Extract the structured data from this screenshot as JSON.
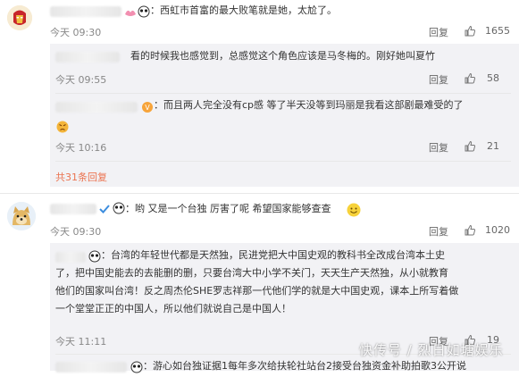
{
  "comments": [
    {
      "text": "：西虹市首富的最大败笔就是她，太尬了。",
      "time": "今天 09:30",
      "reply": "回复",
      "likes": "1655",
      "replies": [
        {
          "text": "看的时候我也感觉到，总感觉这个角色应该是马冬梅的。刚好她叫夏竹",
          "time": "今天 09:55",
          "reply": "回复",
          "likes": "58"
        },
        {
          "text": "：而且两人完全没有cp感 等了半天没等到玛丽是我看这部剧最难受的了",
          "time": "今天 10:16",
          "reply": "回复",
          "likes": "21"
        }
      ],
      "more_replies": "共31条回复"
    },
    {
      "text": "：哟 又是一个台独 厉害了呢 希望国家能够查查",
      "time": "今天 09:30",
      "reply": "回复",
      "likes": "1020",
      "replies": [
        {
          "lines": [
            "：台湾的年轻世代都是天然独，民进党把大中国史观的教科书全改成台湾本土史",
            "了，把中国史能去的去能删的删，只要台湾大中小学不关门，天天生产天然独，从小就教育",
            "他们的国家叫台湾！反之周杰伦SHE罗志祥那一代他们学的就是大中国史观，课本上所写着做",
            "一个堂堂正正的中国人，所以他们就说自己是中国人！"
          ],
          "time": "今天 11:11",
          "reply": "回复",
          "likes": "19"
        },
        {
          "text": "：游心如台独证据1每年多次给扶轮社站台2接受台独资金补助拍歌3公开说",
          "time": "",
          "reply": "",
          "likes": ""
        }
      ]
    }
  ],
  "watermark": "快传号 / 烈日如塘娱乐",
  "colors": {
    "accent": "#eb7350",
    "reply_bg": "#f2f2f5"
  }
}
